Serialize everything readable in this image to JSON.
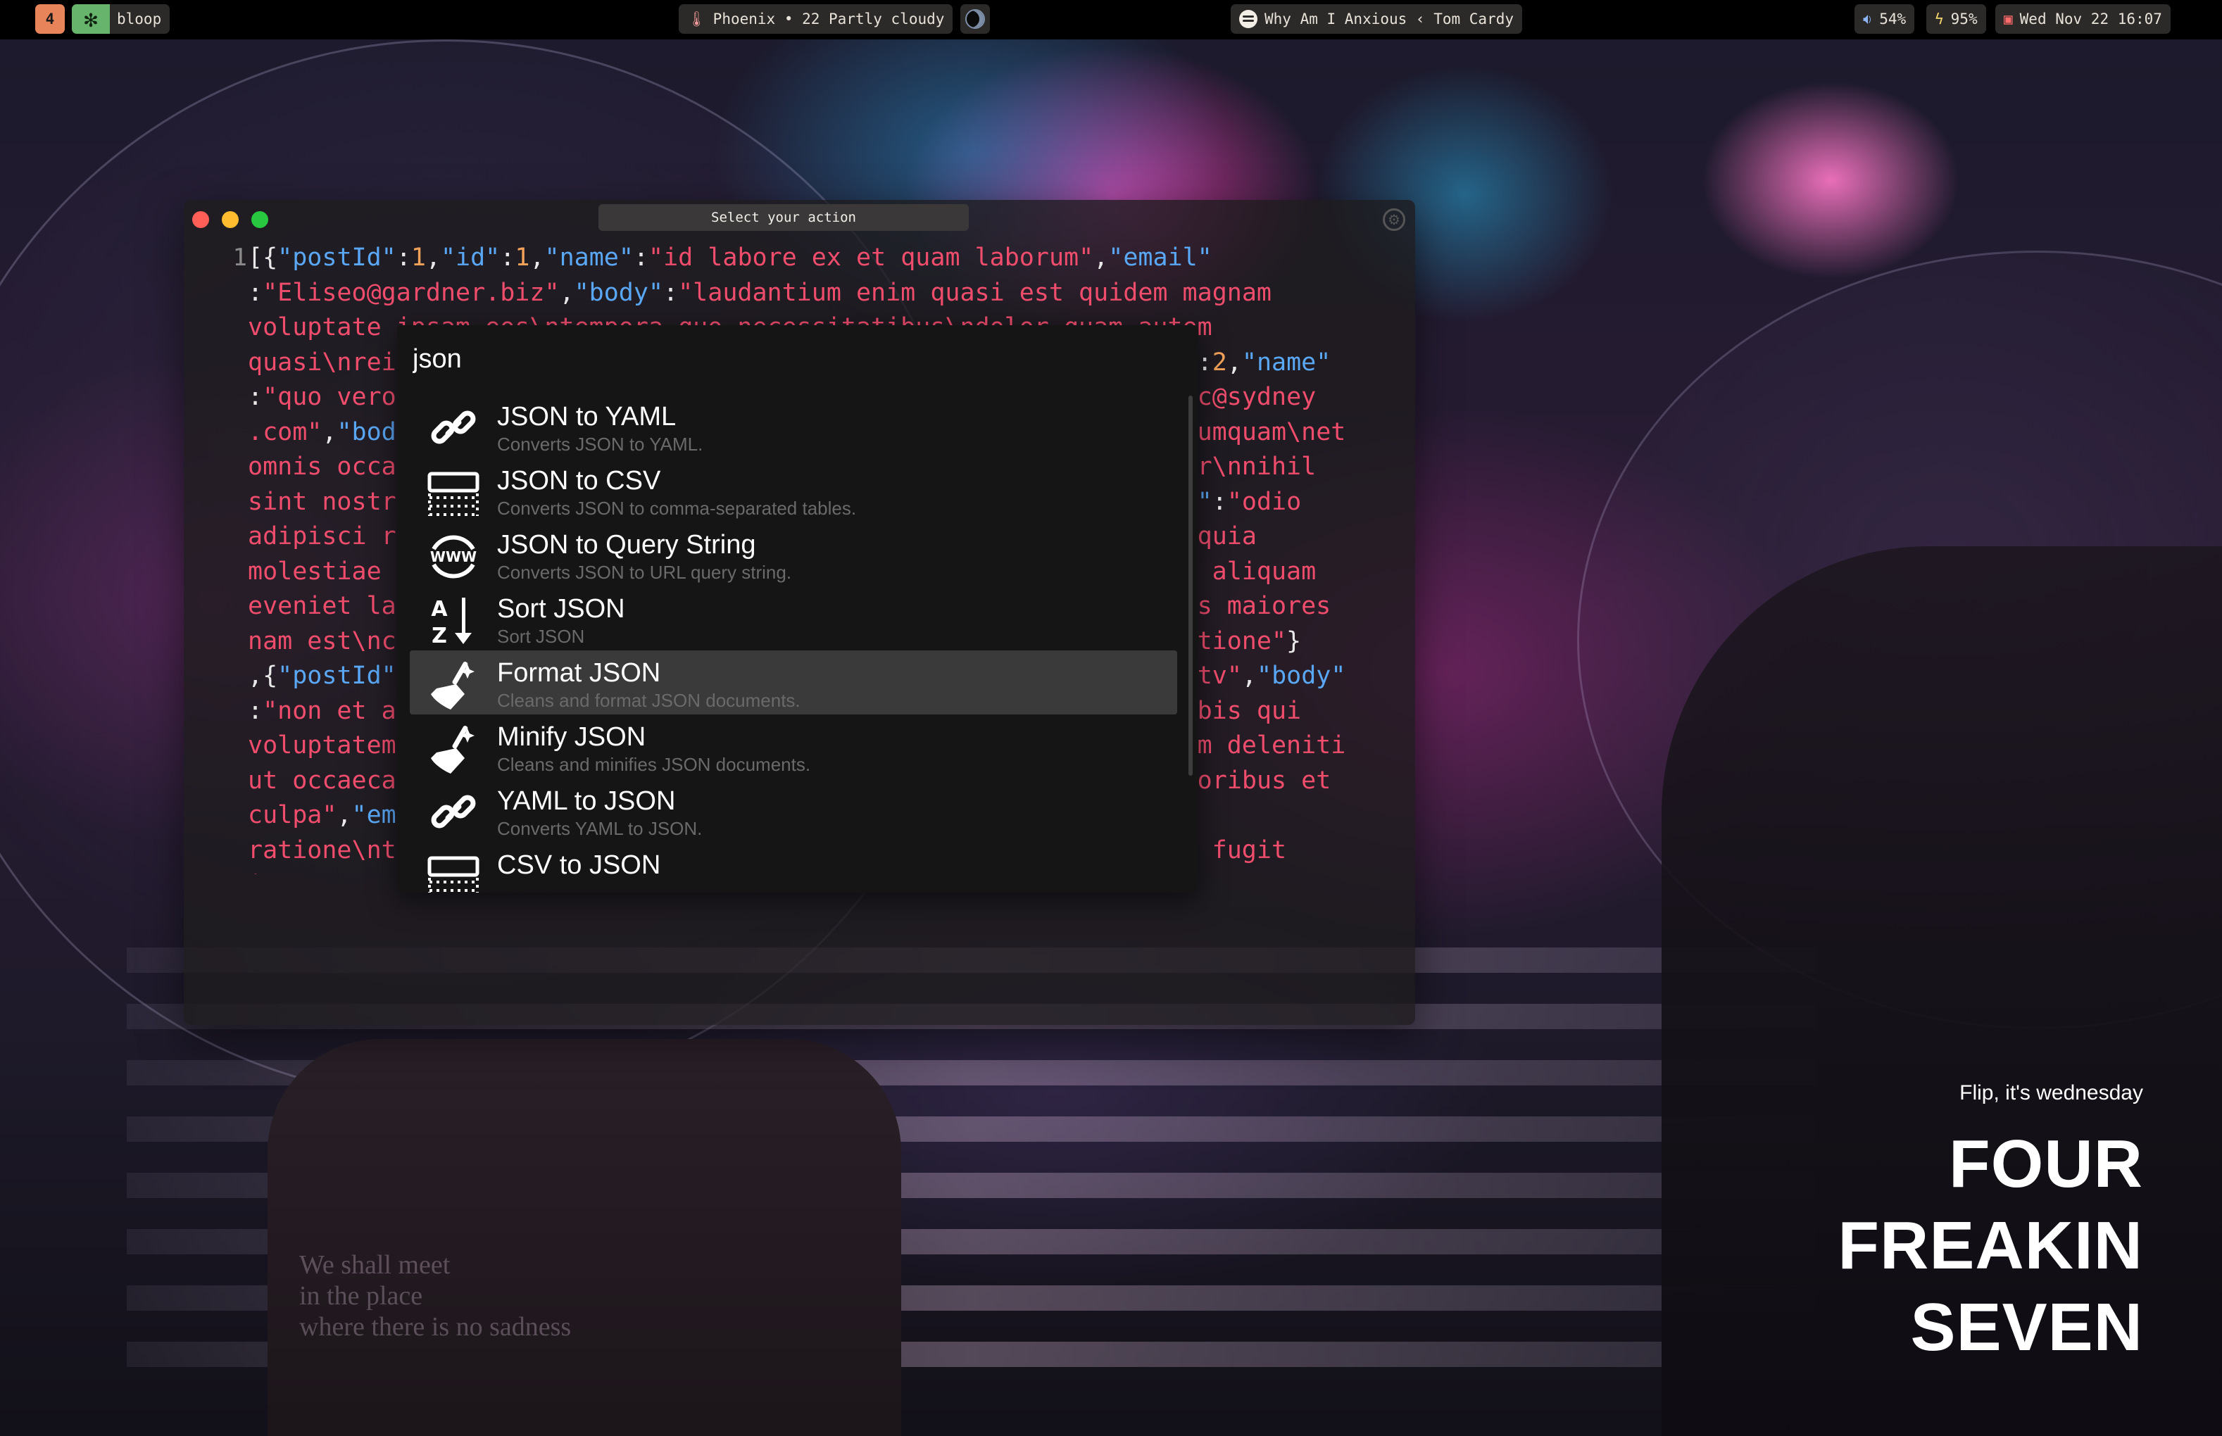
{
  "topbar": {
    "workspace_number": "4",
    "workspace_icon": "asterisk-icon",
    "workspace_name": "bloop",
    "weather": {
      "icon": "thermometer-icon",
      "text": "Phoenix • 22 Partly cloudy"
    },
    "moon_icon": "moon-phase-icon",
    "music": {
      "icon": "spotify-icon",
      "text": "Why Am I Anxious ‹ Tom Cardy"
    },
    "volume": {
      "icon": "speaker-icon",
      "text": "54%"
    },
    "battery": {
      "icon": "bolt-icon",
      "text": "95%"
    },
    "clock": {
      "icon": "calendar-icon",
      "text": "Wed Nov 22 16:07"
    }
  },
  "editor": {
    "title": "Select your action",
    "line_number": "1"
  },
  "palette": {
    "query": "json",
    "items": [
      {
        "name": "JSON to YAML",
        "description": "Converts JSON to YAML.",
        "icon": "link-icon"
      },
      {
        "name": "JSON to CSV",
        "description": "Converts JSON to comma-separated tables.",
        "icon": "table-icon"
      },
      {
        "name": "JSON to Query String",
        "description": "Converts JSON to URL query string.",
        "icon": "www-icon"
      },
      {
        "name": "Sort JSON",
        "description": "Sort JSON",
        "icon": "sort-az-icon"
      },
      {
        "name": "Format JSON",
        "description": "Cleans and format JSON documents.",
        "icon": "broom-icon",
        "selected": true
      },
      {
        "name": "Minify JSON",
        "description": "Cleans and minifies JSON documents.",
        "icon": "broom-icon"
      },
      {
        "name": "YAML to JSON",
        "description": "Converts YAML to JSON.",
        "icon": "link-icon"
      },
      {
        "name": "CSV to JSON",
        "description": "",
        "icon": "table-icon"
      }
    ]
  },
  "widget": {
    "subtitle": "Flip, it's wednesday",
    "lines": [
      "FOUR",
      "FREAKIN",
      "SEVEN"
    ]
  },
  "wallpaper": {
    "jacket_text": "We shall meet\nin the place\nwhere there is no sadness"
  }
}
